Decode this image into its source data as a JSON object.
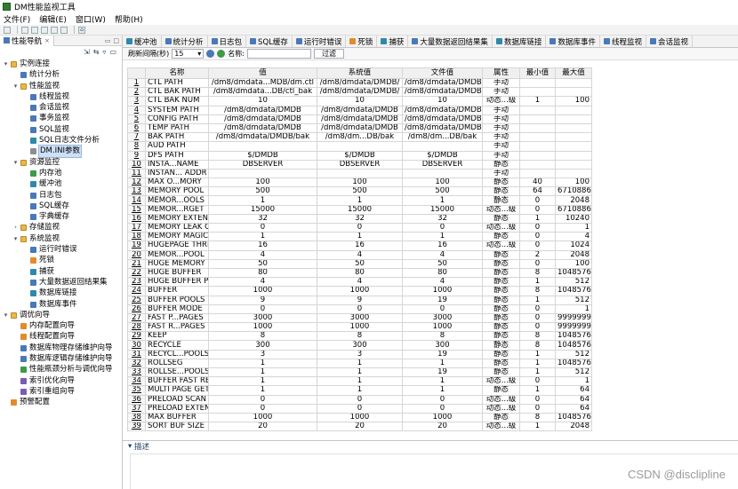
{
  "app": {
    "title": "DM性能监视工具"
  },
  "menu": [
    "文件(F)",
    "编辑(E)",
    "窗口(W)",
    "帮助(H)"
  ],
  "left_panel": {
    "tab_label": "性能导航",
    "tree": [
      {
        "label": "实例连接",
        "level": 0,
        "expander": "▾",
        "icon": "folder"
      },
      {
        "label": "统计分析",
        "level": 1,
        "expander": "",
        "icon": "blue"
      },
      {
        "label": "性能监视",
        "level": 1,
        "expander": "▾",
        "icon": "folder"
      },
      {
        "label": "线程监视",
        "level": 2,
        "expander": "",
        "icon": "blue"
      },
      {
        "label": "会话监视",
        "level": 2,
        "expander": "",
        "icon": "blue"
      },
      {
        "label": "事务监视",
        "level": 2,
        "expander": "",
        "icon": "blue"
      },
      {
        "label": "SQL监视",
        "level": 2,
        "expander": "",
        "icon": "blue"
      },
      {
        "label": "SQL日志文件分析",
        "level": 2,
        "expander": "",
        "icon": "teal"
      },
      {
        "label": "DM.INI参数",
        "level": 2,
        "expander": "",
        "icon": "gray",
        "selected": true
      },
      {
        "label": "资源监控",
        "level": 1,
        "expander": "▾",
        "icon": "folder"
      },
      {
        "label": "内存池",
        "level": 2,
        "expander": "",
        "icon": "green"
      },
      {
        "label": "缓冲池",
        "level": 2,
        "expander": "",
        "icon": "teal"
      },
      {
        "label": "日志包",
        "level": 2,
        "expander": "",
        "icon": "blue"
      },
      {
        "label": "SQL缓存",
        "level": 2,
        "expander": "",
        "icon": "blue"
      },
      {
        "label": "字典缓存",
        "level": 2,
        "expander": "",
        "icon": "blue"
      },
      {
        "label": "存储监视",
        "level": 1,
        "expander": "›",
        "icon": "folder"
      },
      {
        "label": "系统监视",
        "level": 1,
        "expander": "▾",
        "icon": "folder"
      },
      {
        "label": "运行时错误",
        "level": 2,
        "expander": "",
        "icon": "blue"
      },
      {
        "label": "死锁",
        "level": 2,
        "expander": "",
        "icon": "orange"
      },
      {
        "label": "捕获",
        "level": 2,
        "expander": "",
        "icon": "teal"
      },
      {
        "label": "大量数据返回结果集",
        "level": 2,
        "expander": "",
        "icon": "blue"
      },
      {
        "label": "数据库链接",
        "level": 2,
        "expander": "",
        "icon": "teal"
      },
      {
        "label": "数据库事件",
        "level": 2,
        "expander": "",
        "icon": "blue"
      },
      {
        "label": "调优向导",
        "level": 0,
        "expander": "▾",
        "icon": "folder"
      },
      {
        "label": "内存配置向导",
        "level": 1,
        "expander": "",
        "icon": "orange"
      },
      {
        "label": "线程配置向导",
        "level": 1,
        "expander": "",
        "icon": "orange"
      },
      {
        "label": "数据库物理存储维护向导",
        "level": 1,
        "expander": "",
        "icon": "blue"
      },
      {
        "label": "数据库逻辑存储维护向导",
        "level": 1,
        "expander": "",
        "icon": "blue"
      },
      {
        "label": "性能瓶颈分析与调优向导",
        "level": 1,
        "expander": "",
        "icon": "green"
      },
      {
        "label": "索引优化向导",
        "level": 1,
        "expander": "",
        "icon": "purple"
      },
      {
        "label": "索引重组向导",
        "level": 1,
        "expander": "",
        "icon": "purple"
      },
      {
        "label": "预警配置",
        "level": 0,
        "expander": "",
        "icon": "orange"
      }
    ]
  },
  "tabs": [
    {
      "label": "缓冲池",
      "icon": "teal"
    },
    {
      "label": "统计分析",
      "icon": "blue"
    },
    {
      "label": "日志包",
      "icon": "blue"
    },
    {
      "label": "SQL缓存",
      "icon": "blue"
    },
    {
      "label": "运行时错误",
      "icon": "blue"
    },
    {
      "label": "死锁",
      "icon": "orange"
    },
    {
      "label": "捕获",
      "icon": "teal"
    },
    {
      "label": "大量数据返回结果集",
      "icon": "blue"
    },
    {
      "label": "数据库链接",
      "icon": "teal"
    },
    {
      "label": "数据库事件",
      "icon": "blue"
    },
    {
      "label": "线程监视",
      "icon": "blue"
    },
    {
      "label": "会话监视",
      "icon": "blue"
    }
  ],
  "filter": {
    "refresh_label": "刷新间隔(秒)",
    "refresh_value": "15",
    "name_label": "名称:",
    "filter_button": "过滤"
  },
  "table": {
    "headers": [
      "",
      "名称",
      "值",
      "系统值",
      "文件值",
      "属性",
      "最小值",
      "最大值"
    ],
    "rows": [
      [
        "1",
        "CTL PATH",
        "/dm8/dmdata...MDB/dm.ctl",
        "/dm8/dmdata/DMDB/",
        "/dm8/dmdata/DMDB/",
        "手动",
        "",
        ""
      ],
      [
        "2",
        "CTL BAK PATH",
        "/dm8/dmdata...DB/ctl_bak",
        "/dm8/dmdata/DMDB/",
        "/dm8/dmdata/DMDB/",
        "手动",
        "",
        ""
      ],
      [
        "3",
        "CTL BAK NUM",
        "10",
        "10",
        "10",
        "动态...级",
        "1",
        "100"
      ],
      [
        "4",
        "SYSTEM PATH",
        "/dm8/dmdata/DMDB",
        "/dm8/dmdata/DMDB",
        "/dm8/dmdata/DMDB",
        "手动",
        "",
        ""
      ],
      [
        "5",
        "CONFIG PATH",
        "/dm8/dmdata/DMDB",
        "/dm8/dmdata/DMDB",
        "/dm8/dmdata/DMDB",
        "手动",
        "",
        ""
      ],
      [
        "6",
        "TEMP PATH",
        "/dm8/dmdata/DMDB",
        "/dm8/dmdata/DMDB",
        "/dm8/dmdata/DMDB",
        "手动",
        "",
        ""
      ],
      [
        "7",
        "BAK PATH",
        "/dm8/dmdata/DMDB/bak",
        "/dm8/dm...DB/bak",
        "/dm8/dm...DB/bak",
        "手动",
        "",
        ""
      ],
      [
        "8",
        "AUD PATH",
        "",
        "",
        "",
        "手动",
        "",
        ""
      ],
      [
        "9",
        "DFS PATH",
        "$/DMDB",
        "$/DMDB",
        "$/DMDB",
        "手动",
        "",
        ""
      ],
      [
        "10",
        "INSTA...NAME",
        "DBSERVER",
        "DBSERVER",
        "DBSERVER",
        "静态",
        "",
        ""
      ],
      [
        "11",
        "INSTAN... ADDR",
        "",
        "",
        "",
        "手动",
        "",
        ""
      ],
      [
        "12",
        "MAX O...MORY",
        "100",
        "100",
        "100",
        "静态",
        "40",
        "100"
      ],
      [
        "13",
        "MEMORY POOL",
        "500",
        "500",
        "500",
        "静态",
        "64",
        "67108864"
      ],
      [
        "14",
        "MEMOR...OOLS",
        "1",
        "1",
        "1",
        "静态",
        "0",
        "2048"
      ],
      [
        "15",
        "MEMOR...RGET",
        "15000",
        "15000",
        "15000",
        "动态...级",
        "0",
        "67108864"
      ],
      [
        "16",
        "MEMORY EXTEN",
        "32",
        "32",
        "32",
        "静态",
        "1",
        "10240"
      ],
      [
        "17",
        "MEMORY LEAK C",
        "0",
        "0",
        "0",
        "动态...级",
        "0",
        "1"
      ],
      [
        "18",
        "MEMORY MAGIC",
        "1",
        "1",
        "1",
        "静态",
        "0",
        "4"
      ],
      [
        "19",
        "HUGEPAGE THRI",
        "16",
        "16",
        "16",
        "动态...级",
        "0",
        "1024"
      ],
      [
        "20",
        "MEMOR...POOL",
        "4",
        "4",
        "4",
        "静态",
        "2",
        "2048"
      ],
      [
        "21",
        "HUGE MEMORY",
        "50",
        "50",
        "50",
        "静态",
        "0",
        "100"
      ],
      [
        "22",
        "HUGE BUFFER",
        "80",
        "80",
        "80",
        "静态",
        "8",
        "1048576"
      ],
      [
        "23",
        "HUGE BUFFER PI",
        "4",
        "4",
        "4",
        "静态",
        "1",
        "512"
      ],
      [
        "24",
        "BUFFER",
        "1000",
        "1000",
        "1000",
        "静态",
        "8",
        "1048576"
      ],
      [
        "25",
        "BUFFER POOLS",
        "9",
        "9",
        "19",
        "静态",
        "1",
        "512"
      ],
      [
        "26",
        "BUFFER MODE",
        "0",
        "0",
        "0",
        "静态",
        "0",
        "1"
      ],
      [
        "27",
        "FAST P...PAGES",
        "3000",
        "3000",
        "3000",
        "静态",
        "0",
        "99999999"
      ],
      [
        "28",
        "FAST R...PAGES",
        "1000",
        "1000",
        "1000",
        "静态",
        "0",
        "9999999"
      ],
      [
        "29",
        "KEEP",
        "8",
        "8",
        "8",
        "静态",
        "8",
        "1048576"
      ],
      [
        "30",
        "RECYCLE",
        "300",
        "300",
        "300",
        "静态",
        "8",
        "1048576"
      ],
      [
        "31",
        "RECYCL...POOLS",
        "3",
        "3",
        "19",
        "静态",
        "1",
        "512"
      ],
      [
        "32",
        "ROLLSEG",
        "1",
        "1",
        "1",
        "静态",
        "1",
        "1048576"
      ],
      [
        "33",
        "ROLLSE...POOLS",
        "1",
        "1",
        "19",
        "静态",
        "1",
        "512"
      ],
      [
        "34",
        "BUFFER FAST RE",
        "1",
        "1",
        "1",
        "动态...级",
        "0",
        "1"
      ],
      [
        "35",
        "MULTI PAGE GET",
        "1",
        "1",
        "1",
        "静态",
        "1",
        "64"
      ],
      [
        "36",
        "PRELOAD SCAN",
        "0",
        "0",
        "0",
        "动态...级",
        "0",
        "64"
      ],
      [
        "37",
        "PRELOAD EXTEN",
        "0",
        "0",
        "0",
        "动态...级",
        "0",
        "64"
      ],
      [
        "38",
        "MAX BUFFER",
        "1000",
        "1000",
        "1000",
        "静态",
        "8",
        "1048576"
      ],
      [
        "39",
        "SORT BUF SIZE",
        "20",
        "20",
        "20",
        "动态...级",
        "1",
        "2048"
      ]
    ]
  },
  "description": {
    "label": "描述"
  },
  "watermark": "CSDN @disclipline",
  "colors": {
    "selection": "#cde0f7",
    "folder": "#e8b84a",
    "accent": "#4a78b8"
  }
}
